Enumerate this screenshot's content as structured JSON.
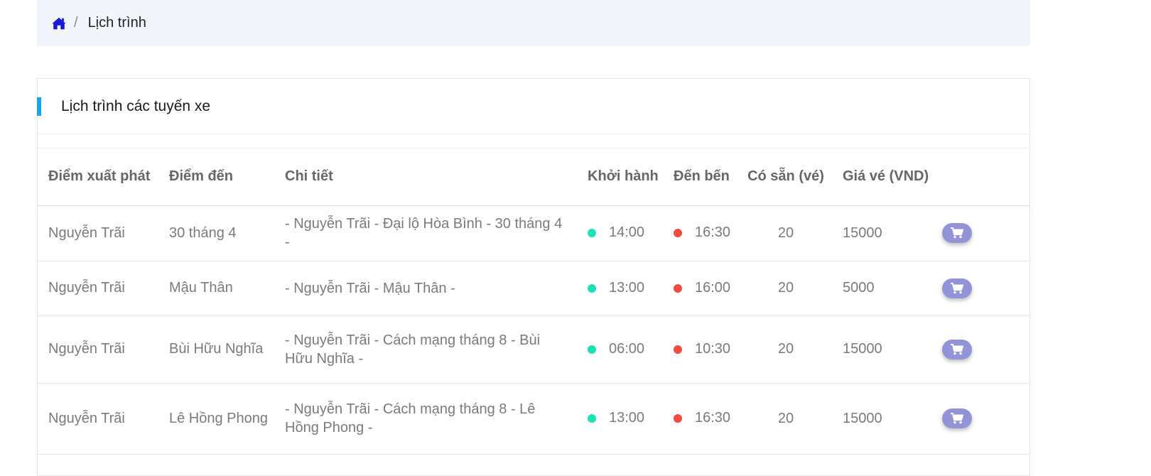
{
  "breadcrumb": {
    "separator": "/",
    "current": "Lịch trình"
  },
  "card": {
    "title": "Lịch trình các tuyến xe"
  },
  "table": {
    "headers": [
      "Điểm xuất phát",
      "Điểm đến",
      "Chi tiết",
      "Khởi hành",
      "Đến bến",
      "Có sẵn (vé)",
      "Giá vé (VND)"
    ],
    "rows": [
      {
        "from": "Nguyễn Trãi",
        "to": "30 tháng 4",
        "detail": "- Nguyễn Trãi - Đại lộ Hòa Bình - 30 tháng 4 -",
        "depart": "14:00",
        "arrive": "16:30",
        "available": "20",
        "price": "15000"
      },
      {
        "from": "Nguyễn Trãi",
        "to": "Mậu Thân",
        "detail": "- Nguyễn Trãi - Mậu Thân -",
        "depart": "13:00",
        "arrive": "16:00",
        "available": "20",
        "price": "5000"
      },
      {
        "from": "Nguyễn Trãi",
        "to": "Bùi Hữu Nghĩa",
        "detail": "- Nguyễn Trãi - Cách mạng tháng 8 - Bùi Hữu Nghĩa -",
        "depart": "06:00",
        "arrive": "10:30",
        "available": "20",
        "price": "15000"
      },
      {
        "from": "Nguyễn Trãi",
        "to": "Lê Hồng Phong",
        "detail": "- Nguyễn Trãi - Cách mạng tháng 8 - Lê Hồng Phong -",
        "depart": "13:00",
        "arrive": "16:30",
        "available": "20",
        "price": "15000"
      }
    ]
  },
  "colors": {
    "accent": "#1aa3e8",
    "home_icon": "#1a1ad6",
    "depart_dot": "#1de0b4",
    "arrive_dot": "#f14a3f",
    "cart_button": "#9393d8"
  },
  "icons": {
    "home": "home-icon",
    "cart": "cart-icon"
  }
}
